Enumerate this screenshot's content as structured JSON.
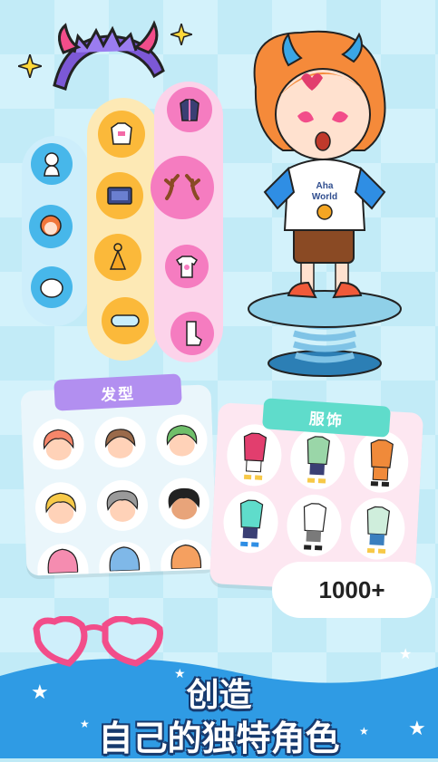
{
  "categories": {
    "hair_tab_label": "发型",
    "outfit_tab_label": "服饰"
  },
  "counter": {
    "label": "1000+"
  },
  "tagline": {
    "line1": "创造",
    "line2": "自己的独特角色"
  },
  "colors": {
    "background": "#c2ebf7",
    "hair_tab": "#b28ff0",
    "outfit_tab": "#5fdccb",
    "column_blue": "#cdeefb",
    "column_yellow": "#fde9b5",
    "column_pink": "#fcd3ea",
    "bottom_band": "#2f9be4"
  },
  "icons": {
    "left_column": [
      "head-icon",
      "hair-icon",
      "face-icon"
    ],
    "middle_column": [
      "shirt-icon",
      "tv-icon",
      "earring-icon",
      "goggles-icon"
    ],
    "right_column": [
      "jacket-icon",
      "antlers-icon",
      "tshirt-icon",
      "sock-icon"
    ]
  },
  "character": {
    "shirt_text_line1": "Aha",
    "shirt_text_line2": "World"
  }
}
